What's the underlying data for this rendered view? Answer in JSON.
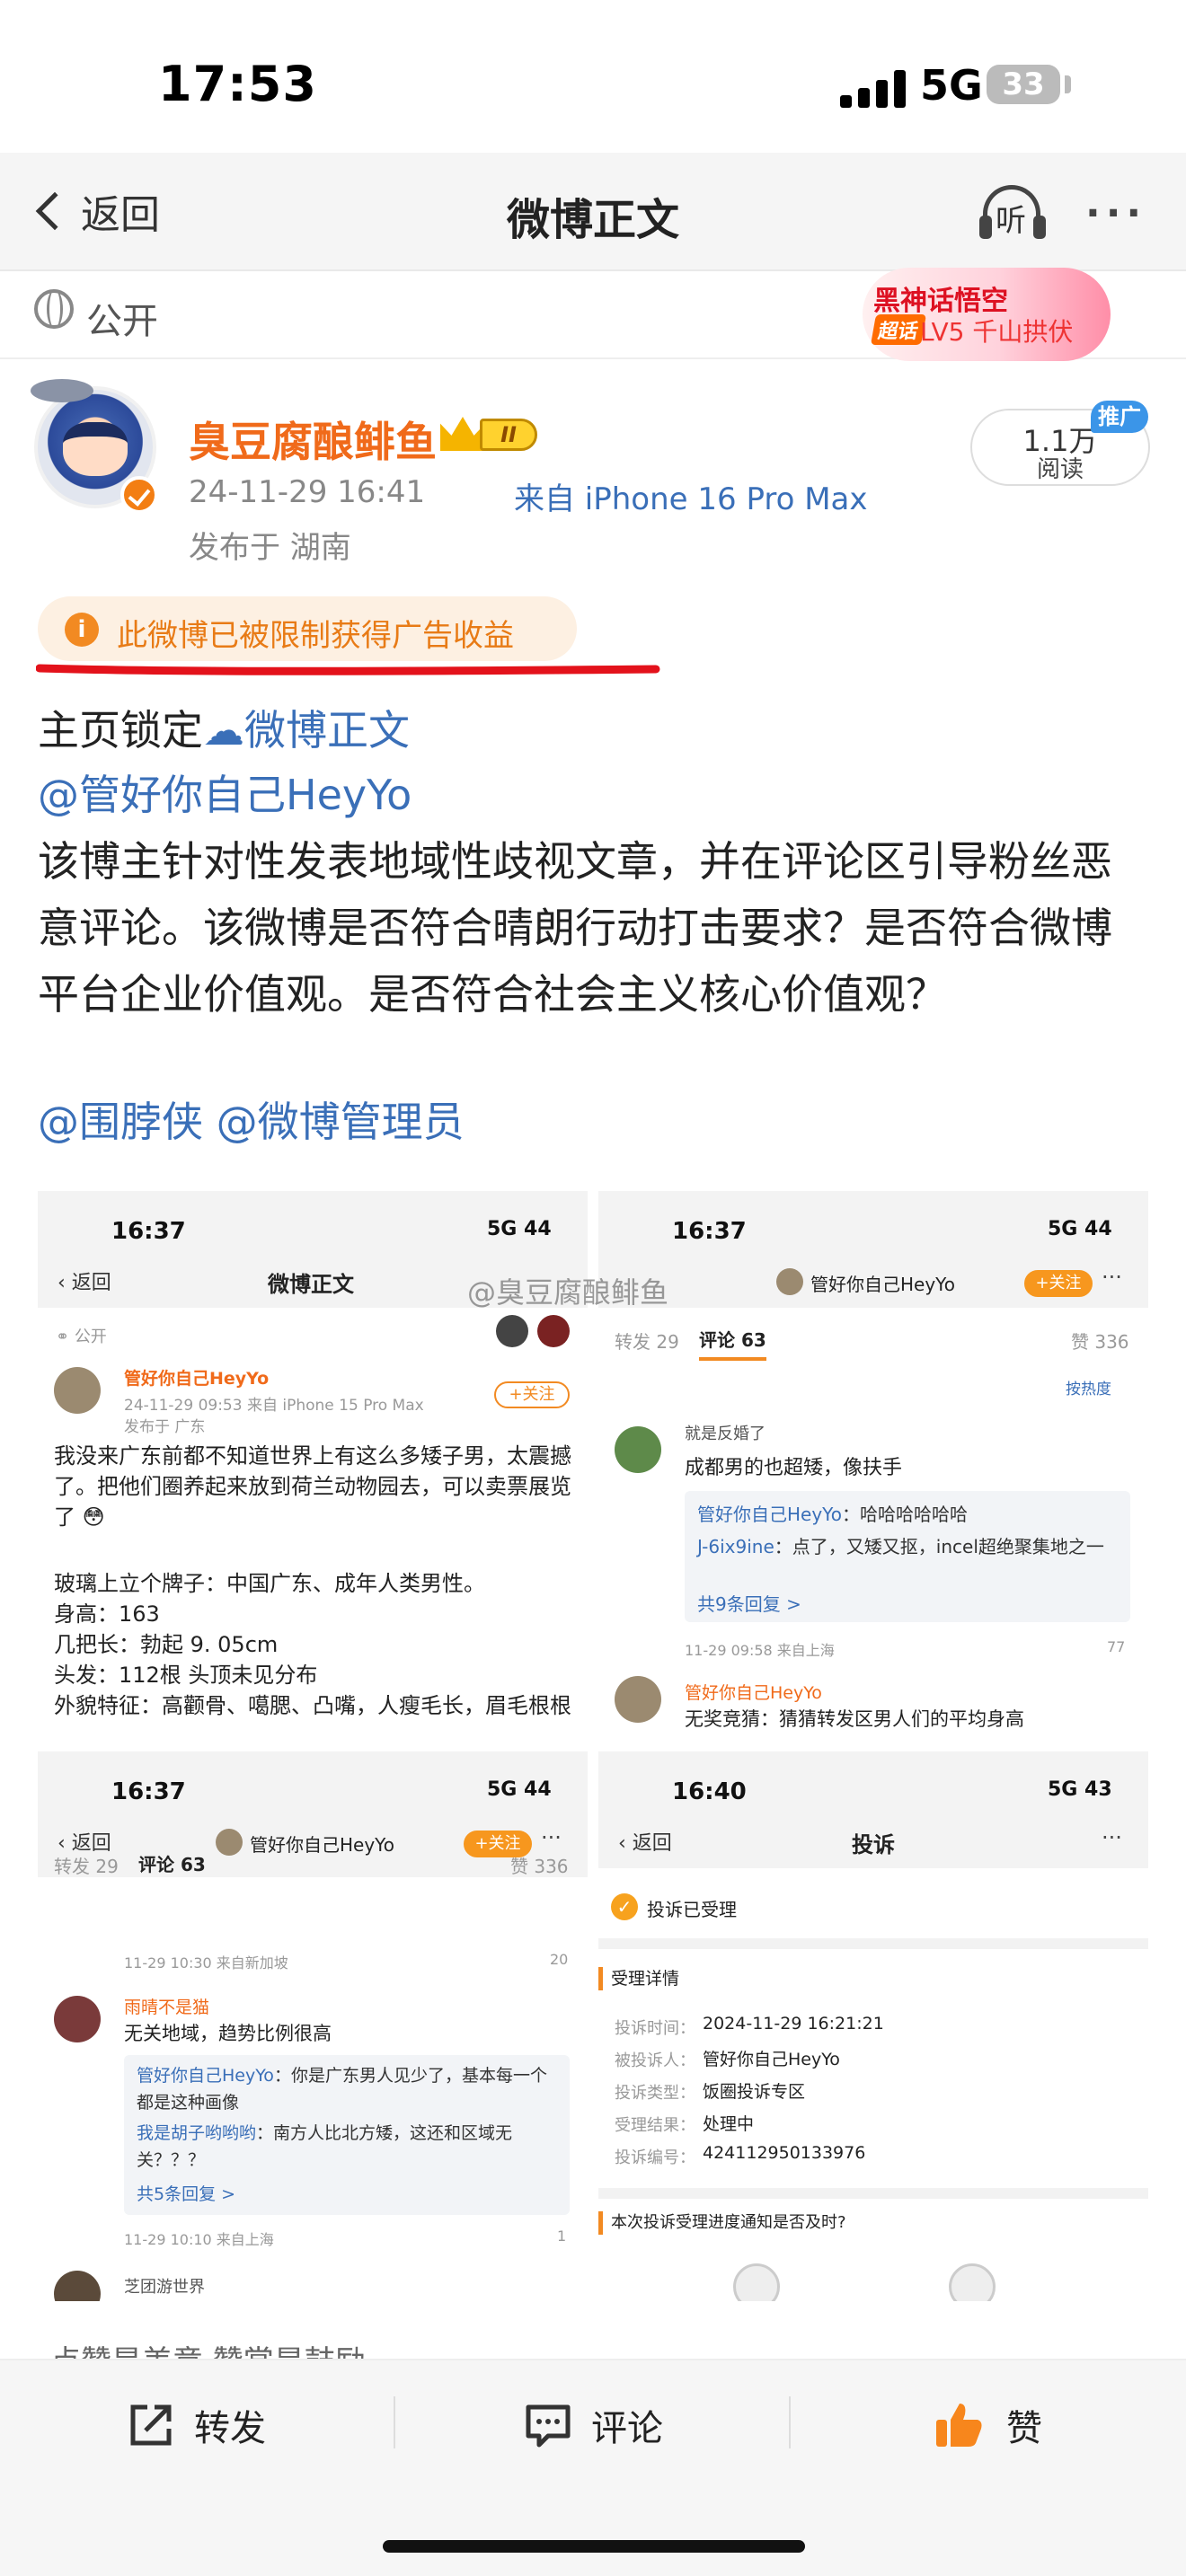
{
  "status_bar": {
    "time": "17:53",
    "network": "5G",
    "battery": "33"
  },
  "nav": {
    "back_label": "返回",
    "title": "微博正文",
    "listen_label": "听",
    "more_label": "···"
  },
  "visibility": {
    "label": "公开"
  },
  "promo": {
    "title": "黑神话悟空",
    "badge": "超话",
    "subtitle": "LV5 千山拱伏"
  },
  "author": {
    "name": "臭豆腐酿鲱鱼",
    "level_badge": "II",
    "time": "24-11-29 16:41",
    "source": "来自 iPhone 16 Pro Max",
    "location": "发布于 湖南",
    "views_count": "1.1万",
    "views_label": "阅读",
    "promote_label": "推广"
  },
  "notice": {
    "icon": "i",
    "text": "此微博已被限制获得广告收益"
  },
  "post": {
    "pin_prefix": "主页锁定",
    "pin_link": "微博正文",
    "mention1": "@管好你自己HeyYo",
    "text": "该博主针对性发表地域性歧视文章，并在评论区引导粉丝恶意评论。该微博是否符合晴朗行动打击要求？是否符合微博平台企业价值观。是否符合社会主义核心价值观？",
    "mention2": "@围脖侠",
    "mention3": "@微博管理员"
  },
  "images": {
    "watermark": "@臭豆腐酿鲱鱼",
    "shot1": {
      "time": "16:37",
      "net": "5G 44",
      "back": "返回",
      "title": "微博正文",
      "public": "公开",
      "author": "管好你自己HeyYo",
      "follow": "+关注",
      "meta": "24-11-29 09:53 来自 iPhone 15 Pro Max",
      "location": "发布于 广东",
      "lines": [
        "我没来广东前都不知道世界上有这么多矮子男，太震撼",
        "了。把他们圈养起来放到荷兰动物园去，可以卖票展览",
        "了 😳",
        "",
        "玻璃上立个牌子：中国广东、成年人类男性。",
        "身高：163",
        "几把长：勃起 9. 05cm",
        "头发：112根  头顶未见分布",
        "外貌特征：高颧骨、噶腮、凸嘴，人瘦毛长，眉毛根根"
      ]
    },
    "shot2": {
      "author": "管好你自己HeyYo",
      "follow": "+关注",
      "tab_repost": "转发 29",
      "tab_comment": "评论 63",
      "likes": "赞 336",
      "sort": "按热度",
      "c1_name": "就是反婚了",
      "c1_text": "成都男的也超矮，像扶手",
      "r1_name": "管好你自己HeyYo",
      "r1_text": "：哈哈哈哈哈哈",
      "r2_name": "J-6ix9ine",
      "r2_text": "：点了，又矮又抠，incel超绝聚集地之一",
      "more_replies": "共9条回复 >",
      "c1_meta": "11-29 09:58 来自上海",
      "c1_likes": "77",
      "c2_name": "管好你自己HeyYo",
      "c2_text": "无奖竞猜：猜猜转发区男人们的平均身高"
    },
    "shot3": {
      "time": "16:37",
      "net": "5G 44",
      "back": "返回",
      "author": "管好你自己HeyYo",
      "follow": "+关注",
      "tab_repost": "转发 29",
      "tab_comment": "评论 63",
      "likes": "赞 336",
      "top_meta": "11-29 10:30 来自新加坡",
      "top_likes": "20",
      "c1_name": "雨晴不是猫",
      "c1_text": "无关地域，趋势比例很高",
      "r1_name": "管好你自己HeyYo",
      "r1_text": "：你是广东男人见少了，基本每一个都是这种画像",
      "r2_name": "我是胡子哟哟哟",
      "r2_text": "：南方人比北方矮，这还和区域无关？？？",
      "more_replies": "共5条回复 >",
      "c1_meta": "11-29 10:10 来自上海",
      "c1_likes": "1",
      "c2_name": "芝团游世界"
    },
    "shot4": {
      "time": "16:40",
      "net": "5G 43",
      "back": "返回",
      "title": "投诉",
      "accepted": "投诉已受理",
      "details_title": "受理详情",
      "rows": [
        {
          "k": "投诉时间：",
          "v": "2024-11-29 16:21:21"
        },
        {
          "k": "被投诉人：",
          "v": "管好你自己HeyYo"
        },
        {
          "k": "投诉类型：",
          "v": "饭圈投诉专区"
        },
        {
          "k": "受理结果：",
          "v": "处理中"
        },
        {
          "k": "投诉编号：",
          "v": "424112950133976"
        }
      ],
      "question": "本次投诉受理进度通知是否及时?"
    }
  },
  "tip": "点赞是美意    赞赏是鼓励",
  "bottom_bar": {
    "repost": "转发",
    "comment": "评论",
    "like": "赞"
  },
  "colors": {
    "accent": "#f06a1a",
    "link": "#3a6fb8",
    "notice_bg": "#fdf0e2",
    "like_orange": "#f7861c"
  }
}
